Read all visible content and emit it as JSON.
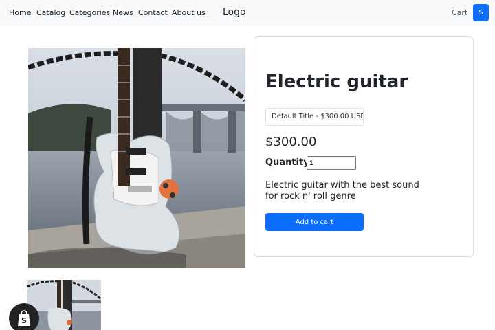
{
  "nav": {
    "links": [
      "Home",
      "Catalog",
      "Categories",
      "News",
      "Contact",
      "About us"
    ],
    "logo": "Logo",
    "cart": "Cart",
    "user_initial": "S"
  },
  "product": {
    "title": "Electric guitar",
    "variant": "Default Title - $300.00 USD",
    "price": "$300.00",
    "quantity_label": "Quantity:",
    "quantity_value": "1",
    "description": "Electric guitar with the best sound for rock n' roll genre",
    "add_to_cart": "Add to cart"
  },
  "colors": {
    "primary": "#0d6efd",
    "navbar_bg": "#f8f9fa",
    "badge_bg": "#202223"
  }
}
